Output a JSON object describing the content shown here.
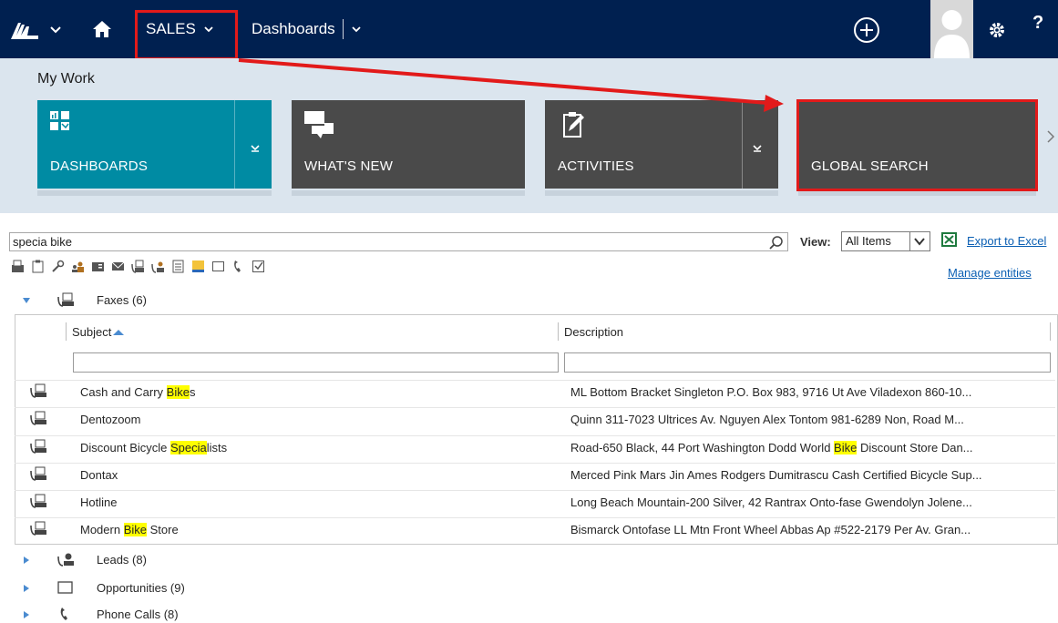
{
  "topnav": {
    "module_label": "SALES",
    "area_label": "Dashboards",
    "help_label": "?"
  },
  "header": {
    "section_title": "My Work",
    "tiles": [
      {
        "label": "DASHBOARDS",
        "color": "#008ba3"
      },
      {
        "label": "WHAT'S NEW",
        "color": "#4a4a4a"
      },
      {
        "label": "ACTIVITIES",
        "color": "#4a4a4a"
      },
      {
        "label": "GLOBAL SEARCH",
        "color": "#4a4a4a"
      }
    ]
  },
  "search": {
    "query": "specia bike",
    "view_label": "View:",
    "view_value": "All Items",
    "export_label": "Export to Excel",
    "manage_label": "Manage entities"
  },
  "groups": [
    {
      "label": "Faxes (6)",
      "expanded": true,
      "icon": "fax-icon"
    },
    {
      "label": "Leads (8)",
      "expanded": false,
      "icon": "lead-icon"
    },
    {
      "label": "Opportunities (9)",
      "expanded": false,
      "icon": "opportunity-icon"
    },
    {
      "label": "Phone Calls (8)",
      "expanded": false,
      "icon": "phone-icon"
    }
  ],
  "grid": {
    "columns": [
      "Subject",
      "Description"
    ],
    "rows": [
      {
        "subject": [
          "Cash and Carry ",
          "Bike",
          "s"
        ],
        "description": [
          "ML Bottom Bracket Singleton P.O. Box 983, 9716 Ut Ave Viladexon 860-10..."
        ]
      },
      {
        "subject": [
          "Dentozoom"
        ],
        "description": [
          "Quinn 311-7023 Ultrices Av. Nguyen Alex Tontom 981-6289 Non, Road M..."
        ]
      },
      {
        "subject": [
          "Discount Bicycle ",
          "Specia",
          "lists"
        ],
        "description": [
          "Road-650 Black, 44 Port Washington Dodd World ",
          "Bike",
          " Discount Store Dan..."
        ]
      },
      {
        "subject": [
          "Dontax"
        ],
        "description": [
          "Merced Pink Mars Jin Ames Rodgers Dumitrascu Cash Certified Bicycle Sup..."
        ]
      },
      {
        "subject": [
          "Hotline"
        ],
        "description": [
          "Long Beach Mountain-200 Silver, 42 Rantrax Onto-fase Gwendolyn Jolene..."
        ]
      },
      {
        "subject": [
          "Modern ",
          "Bike",
          " Store"
        ],
        "description": [
          "Bismarck Ontofase LL Mtn Front Wheel Abbas Ap #522-2179 Per Av. Gran..."
        ]
      }
    ]
  },
  "colors": {
    "nav_bg": "#002050",
    "band_bg": "#dbe5ee",
    "annotation_red": "#e21a1a",
    "highlight": "#ffff00",
    "link": "#0b5fb3"
  }
}
